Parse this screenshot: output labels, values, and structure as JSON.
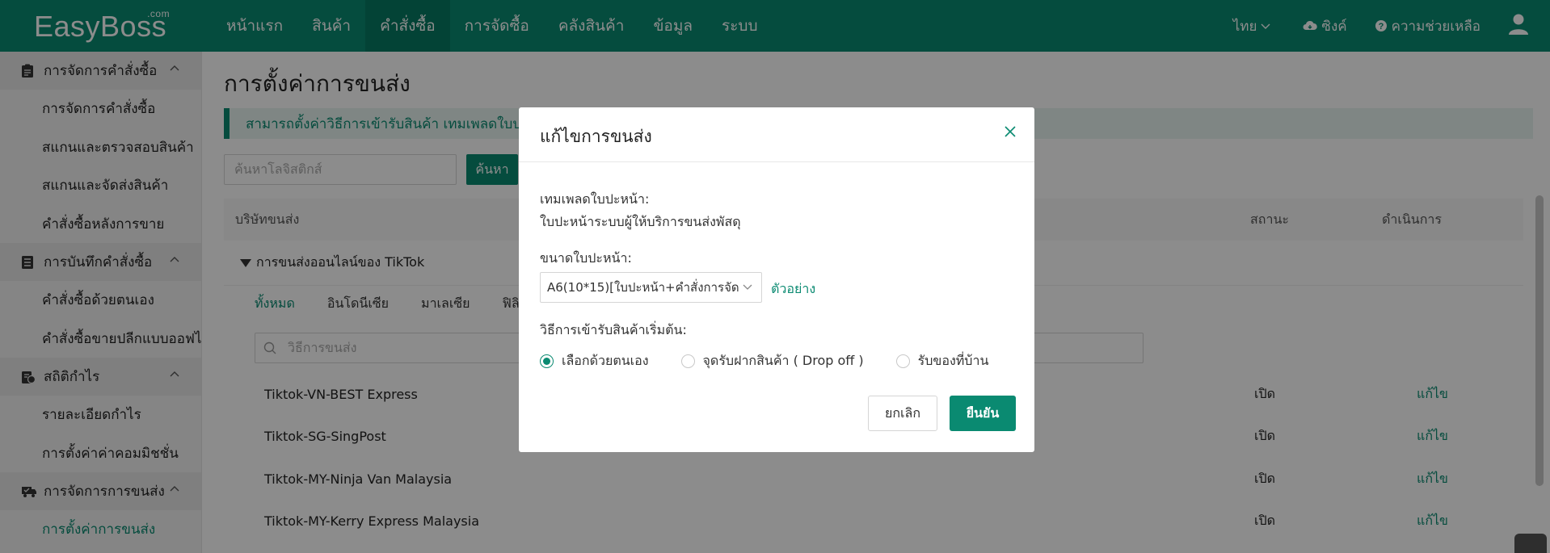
{
  "app": {
    "logo": "EasyBoss",
    "logo_suffix": ".com"
  },
  "topnav": {
    "items": [
      {
        "label": "หน้าแรก",
        "active": false
      },
      {
        "label": "สินค้า",
        "active": false
      },
      {
        "label": "คำสั่งซื้อ",
        "active": true
      },
      {
        "label": "การจัดซื้อ",
        "active": false
      },
      {
        "label": "คลังสินค้า",
        "active": false
      },
      {
        "label": "ข้อมูล",
        "active": false
      },
      {
        "label": "ระบบ",
        "active": false
      }
    ],
    "language": "ไทย",
    "sync": "ซิงค์",
    "help": "ความช่วยเหลือ"
  },
  "sidebar": {
    "groups": [
      {
        "label": "การจัดการคำสั่งซื้อ",
        "icon": "clipboard-icon",
        "items": [
          "การจัดการคำสั่งซื้อ",
          "สแกนและตรวจสอบสินค้า",
          "สแกนและจัดส่งสินค้า",
          "คำสั่งซื้อหลังการขาย"
        ]
      },
      {
        "label": "การบันทึกคำสั่งซื้อ",
        "icon": "record-icon",
        "items": [
          "คำสั่งซื้อด้วยตนเอง",
          "คำสั่งซื้อขายปลีกแบบออฟไลน์"
        ]
      },
      {
        "label": "สถิติกำไร",
        "icon": "stats-icon",
        "items": [
          "รายละเอียดกำไร",
          "การตั้งค่าค่าคอมมิชชั่น"
        ]
      },
      {
        "label": "การจัดการการขนส่ง",
        "icon": "truck-icon",
        "items": [
          "การตั้งค่าการขนส่ง"
        ]
      }
    ],
    "active_item": "การตั้งค่าการขนส่ง"
  },
  "main": {
    "title": "การตั้งค่าการขนส่ง",
    "notice": "สามารถตั้งค่าวิธีการเข้ารับสินค้า เทมเพลดใบปะหน้า",
    "search_placeholder": "ค้นหาโลจิสติกส์",
    "search_button": "ค้นหา",
    "columns": {
      "company": "บริษัทขนส่ง",
      "status": "สถานะ",
      "action": "ดำเนินการ"
    },
    "group_name": "การขนส่งออนไลน์ของ TikTok",
    "country_tabs": [
      "ทั้งหมด",
      "อินโดนีเซีย",
      "มาเลเซีย",
      "ฟิลิ"
    ],
    "method_placeholder": "วิธีการขนส่ง",
    "rows": [
      {
        "name": "Tiktok-VN-BEST Express",
        "status": "เปิด",
        "action": "แก้ไข"
      },
      {
        "name": "Tiktok-SG-SingPost",
        "status": "เปิด",
        "action": "แก้ไข"
      },
      {
        "name": "Tiktok-MY-Ninja Van Malaysia",
        "status": "เปิด",
        "action": "แก้ไข"
      },
      {
        "name": "Tiktok-MY-Kerry Express Malaysia",
        "status": "เปิด",
        "action": "แก้ไข"
      }
    ]
  },
  "modal": {
    "title": "แก้ไขการขนส่ง",
    "template_label": "เทมเพลดใบปะหน้า:",
    "template_value": "ใบปะหน้าระบบผู้ให้บริการขนส่งพัสดุ",
    "size_label": "ขนาดใบปะหน้า:",
    "size_value": "A6(10*15)[ใบปะหน้า+คำสั่งการจัด",
    "example_link": "ตัวอย่าง",
    "pickup_label": "วิธีการเข้ารับสินค้าเริ่มต้น:",
    "pickup_options": [
      {
        "label": "เลือกด้วยตนเอง",
        "selected": true
      },
      {
        "label": "จุดรับฝากสินค้า ( Drop off )",
        "selected": false
      },
      {
        "label": "รับของที่บ้าน",
        "selected": false
      }
    ],
    "cancel": "ยกเลิก",
    "confirm": "ยืนยัน"
  },
  "colors": {
    "brand": "#0a8a71"
  }
}
